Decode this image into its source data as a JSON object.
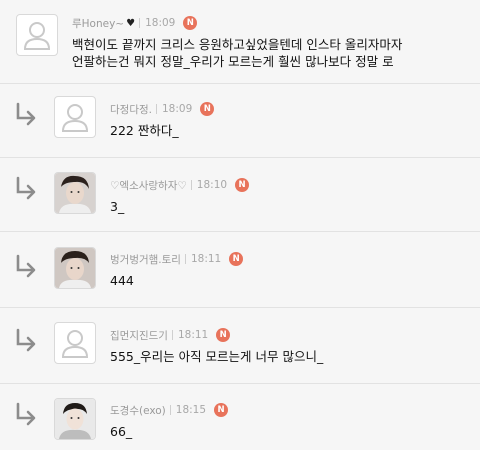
{
  "colors": {
    "new_badge": "#e8735b",
    "background": "#f6f6f6",
    "divider": "#e2e2e2"
  },
  "comments": [
    {
      "author": "루Honey~",
      "author_suffix_icon": "black-heart-icon",
      "time": "18:09",
      "badge": "N",
      "text": "백현이도 끝까지 크리스 응원하고싶었을텐데 인스타 올리자마자\n언팔하는건 뭐지 정말_우리가 모르는게 훨씬 많나보다 정말 로",
      "avatar": "default-avatar-icon",
      "is_reply": false
    },
    {
      "author": "다정다정.",
      "time": "18:09",
      "badge": "N",
      "text": "222 짠하다_",
      "avatar": "default-avatar-icon",
      "is_reply": true
    },
    {
      "author": "♡엑소사랑하자♡",
      "time": "18:10",
      "badge": "N",
      "text": "3_",
      "avatar": "photo",
      "is_reply": true
    },
    {
      "author": "벙거벙거햄.토리",
      "time": "18:11",
      "badge": "N",
      "text": "444",
      "avatar": "photo",
      "is_reply": true
    },
    {
      "author": "집먼지진드기",
      "time": "18:11",
      "badge": "N",
      "text": "555_우리는 아직 모르는게 너무 많으니_",
      "avatar": "default-avatar-icon",
      "is_reply": true
    },
    {
      "author": "도경수(exo)",
      "time": "18:15",
      "badge": "N",
      "text": "66_",
      "avatar": "photo",
      "is_reply": true
    }
  ]
}
